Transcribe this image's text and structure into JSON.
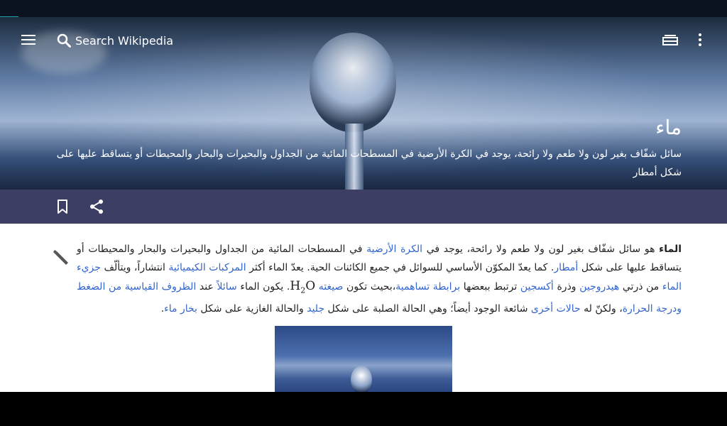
{
  "search": {
    "placeholder": "Search Wikipedia"
  },
  "hero": {
    "title": "ماء",
    "description": "سائل شفّاف بغير لون ولا طعم ولا رائحة، يوجد في الكرة الأرضية في المسطحات المائية من الجداول والبحيرات والبحار والمحيطات أو يتساقط عليها على شكل أمطار"
  },
  "icons": {
    "menu": "menu-icon",
    "search": "search-icon",
    "reading_lists": "reading-list-icon",
    "overflow": "overflow-menu-icon",
    "bookmark": "bookmark-icon",
    "share": "share-icon",
    "edit": "pencil-icon"
  },
  "colors": {
    "action_bar": "#3c3f63",
    "link": "#3366cc",
    "accent": "#1aa3a3"
  },
  "article": {
    "p_lead_bold": "الماء",
    "p_t1": " هو سائل شفّاف بغير لون ولا طعم ولا رائحة، يوجد في ",
    "p_link_earth": "الكرة الأرضية",
    "p_t2": " في المسطحات المائية من الجداول والبحيرات والبحار والمحيطات أو يتساقط عليها على شكل ",
    "p_link_rain": "أمطار",
    "p_t3": ". كما يعدّ المكوّن الأساسي للسوائل في جميع الكائنات الحية. يعدّ الماء أكثر ",
    "p_link_compounds": "المركبات الكيميائية",
    "p_t4": " انتشاراً، ويتألّف ",
    "p_link_molecule": "جزيء الماء",
    "p_t5": " من ذرتي ",
    "p_link_hydrogen": "هيدروجين",
    "p_t6": " وذرة ",
    "p_link_oxygen": "أكسجين",
    "p_t7": " ترتبط ببعضها ",
    "p_link_covalent": "برابطة تساهمية",
    "p_t8": "،بحيث تكون ",
    "p_link_formula": "صيغته",
    "formula_h": "H",
    "formula_sub": "2",
    "formula_o": "O",
    "p_t9": ". يكون الماء ",
    "p_link_liquid": "سائلاً",
    "p_t10": " عند ",
    "p_link_stp": "الظروف القياسية من الضغط ودرجة الحرارة",
    "p_t11": "، ولكنّ له ",
    "p_link_states": "حالات أخرى",
    "p_t12": " شائعة الوجود أيضاً؛ وهي الحالة الصلبة على شكل ",
    "p_link_ice": "جليد",
    "p_t13": " والحالة الغازية على شكل ",
    "p_link_vapor": "بخار ماء",
    "p_t14": "."
  }
}
